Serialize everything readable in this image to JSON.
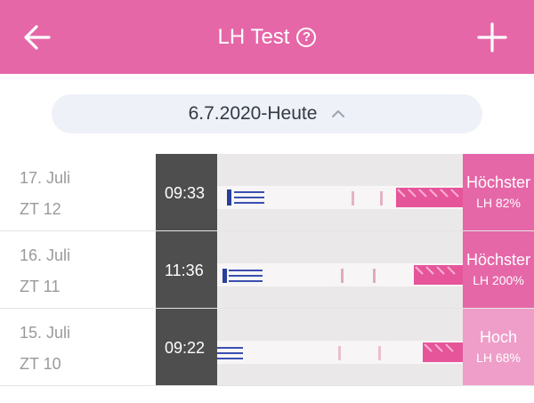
{
  "header": {
    "title": "LH Test",
    "help_icon": "?",
    "back_icon": "arrow-left-icon",
    "add_icon": "plus-icon"
  },
  "date_range": {
    "label": "6.7.2020-Heute",
    "icon": "chevron-up-icon"
  },
  "colors": {
    "brand": "#e667a8",
    "result_high": "#e667a8",
    "result_mid": "#ef9ec9"
  },
  "entries": [
    {
      "date": "17. Juli",
      "cycle_day": "ZT 12",
      "time": "09:33",
      "level": "Höchster",
      "lh": "LH 82%"
    },
    {
      "date": "16. Juli",
      "cycle_day": "ZT 11",
      "time": "11:36",
      "level": "Höchster",
      "lh": "LH 200%"
    },
    {
      "date": "15. Juli",
      "cycle_day": "ZT 10",
      "time": "09:22",
      "level": "Hoch",
      "lh": "LH 68%"
    }
  ]
}
